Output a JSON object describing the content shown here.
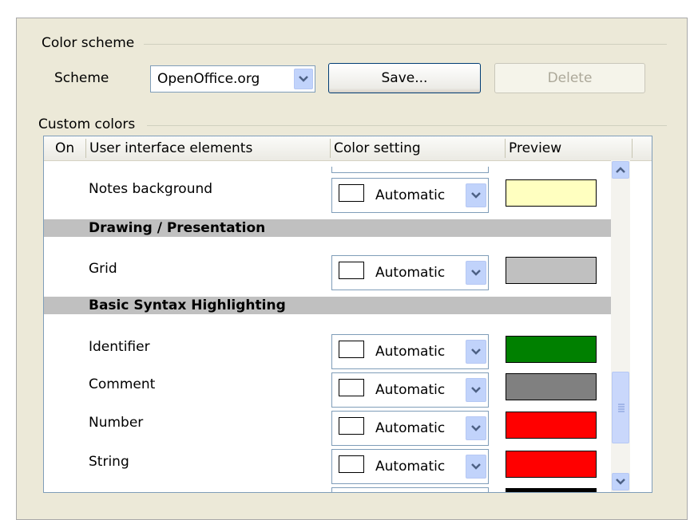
{
  "color_scheme": {
    "group_label": "Color scheme",
    "scheme_label": "Scheme",
    "scheme_value": "OpenOffice.org",
    "save_label": "Save...",
    "delete_label": "Delete"
  },
  "custom_colors": {
    "group_label": "Custom colors",
    "headers": {
      "on": "On",
      "elements": "User interface elements",
      "setting": "Color setting",
      "preview": "Preview"
    },
    "automatic_label": "Automatic",
    "rows": [
      {
        "label": "Notes background",
        "preview_color": "#ffffc0"
      },
      {
        "group": "Drawing / Presentation"
      },
      {
        "label": "Grid",
        "preview_color": "#c0c0c0"
      },
      {
        "group": "Basic Syntax Highlighting"
      },
      {
        "label": "Identifier",
        "preview_color": "#008000"
      },
      {
        "label": "Comment",
        "preview_color": "#808080"
      },
      {
        "label": "Number",
        "preview_color": "#ff0000"
      },
      {
        "label": "String",
        "preview_color": "#ff0000"
      }
    ]
  }
}
